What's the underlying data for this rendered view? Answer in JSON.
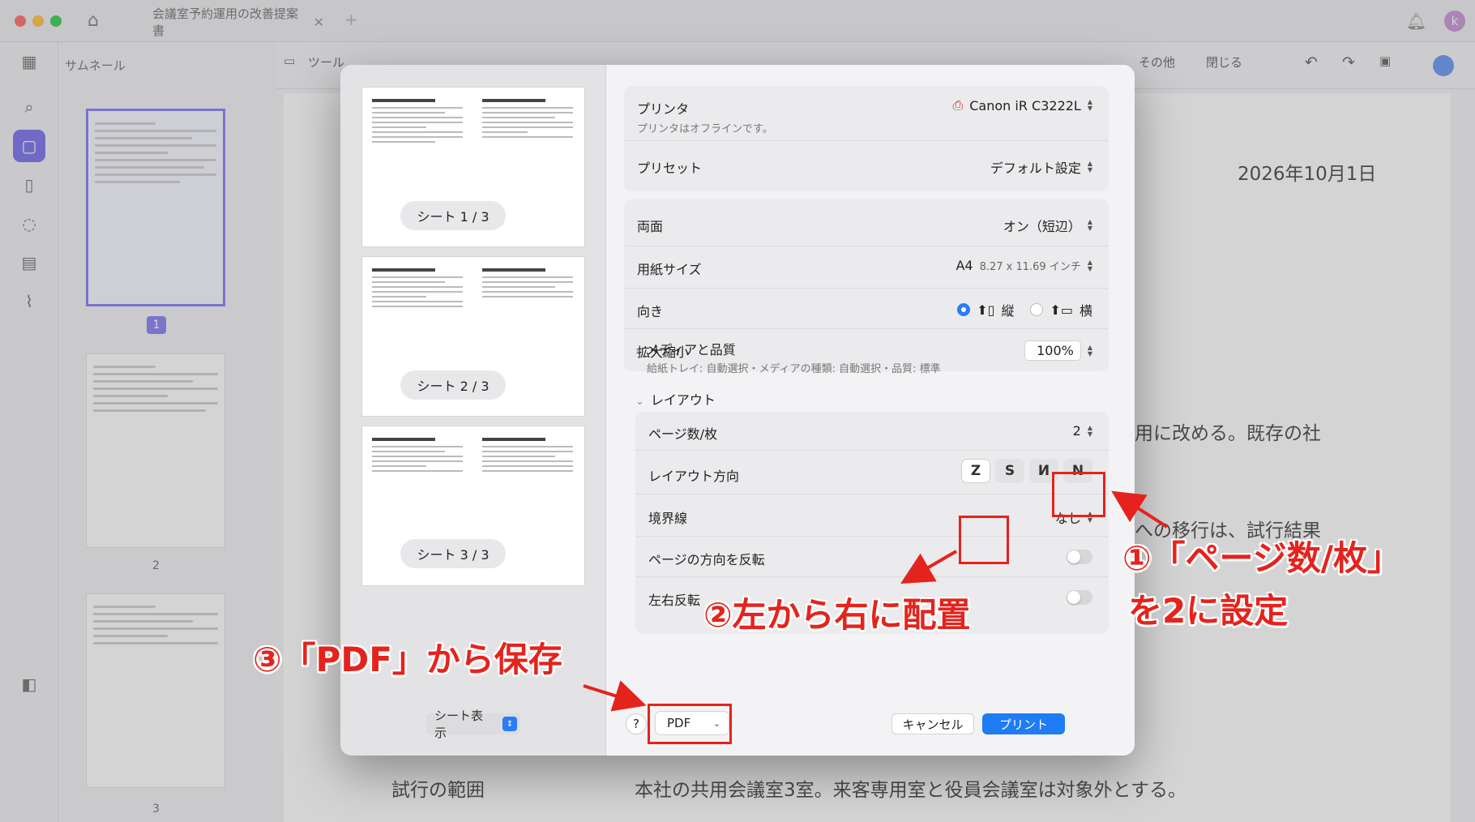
{
  "titlebar": {
    "tab_title": "会議室予約運用の改善提案書",
    "account_initial": "k"
  },
  "thumbnails": {
    "panel_title": "サムネール",
    "pages": [
      "1",
      "2",
      "3"
    ]
  },
  "toolbar": {
    "tool_label": "ツール",
    "other_label": "その他",
    "close_label": "閉じる"
  },
  "document": {
    "date": "2026年10月1日",
    "line1": "用に改める。既存の社",
    "line2": "への移行は、試行結果",
    "scope_label": "試行の範囲",
    "scope_text": "本社の共用会議室3室。来客専用室と役員会議室は対象外とする。"
  },
  "print_dialog": {
    "sheets": [
      "シート 1 / 3",
      "シート 2 / 3",
      "シート 3 / 3"
    ],
    "sheet_view_label": "シート表示",
    "printer": {
      "label": "プリンタ",
      "value": "Canon iR C3222L",
      "status": "プリンタはオフラインです。"
    },
    "preset": {
      "label": "プリセット",
      "value": "デフォルト設定"
    },
    "duplex": {
      "label": "両面",
      "value": "オン（短辺）"
    },
    "paper_size": {
      "label": "用紙サイズ",
      "value": "A4",
      "detail": "8.27 x 11.69 インチ"
    },
    "orientation": {
      "label": "向き",
      "portrait": "縦",
      "landscape": "横",
      "selected": "portrait"
    },
    "scale": {
      "label": "拡大縮小",
      "value": "100%"
    },
    "media_quality": {
      "header": "メディアと品質",
      "summary": "給紙トレイ: 自動選択・メディアの種類: 自動選択・品質: 標準"
    },
    "layout": {
      "header": "レイアウト",
      "pages_per_sheet": {
        "label": "ページ数/枚",
        "value": "2"
      },
      "direction": {
        "label": "レイアウト方向",
        "options": [
          "Z",
          "S",
          "И",
          "N"
        ],
        "selected": 0
      },
      "border": {
        "label": "境界線",
        "value": "なし"
      },
      "two_sided": {
        "label": "ページの方向を反転"
      },
      "flip": {
        "label": "左右反転"
      }
    },
    "help_label": "?",
    "pdf_label": "PDF",
    "cancel_label": "キャンセル",
    "print_label": "プリント"
  },
  "annotations": {
    "step1_line1": "①「ページ数/枚」",
    "step1_line2": "を2に設定",
    "step2": "②左から右に配置",
    "step3": "③「PDF」から保存",
    "highlight_color": "#e5231d"
  }
}
